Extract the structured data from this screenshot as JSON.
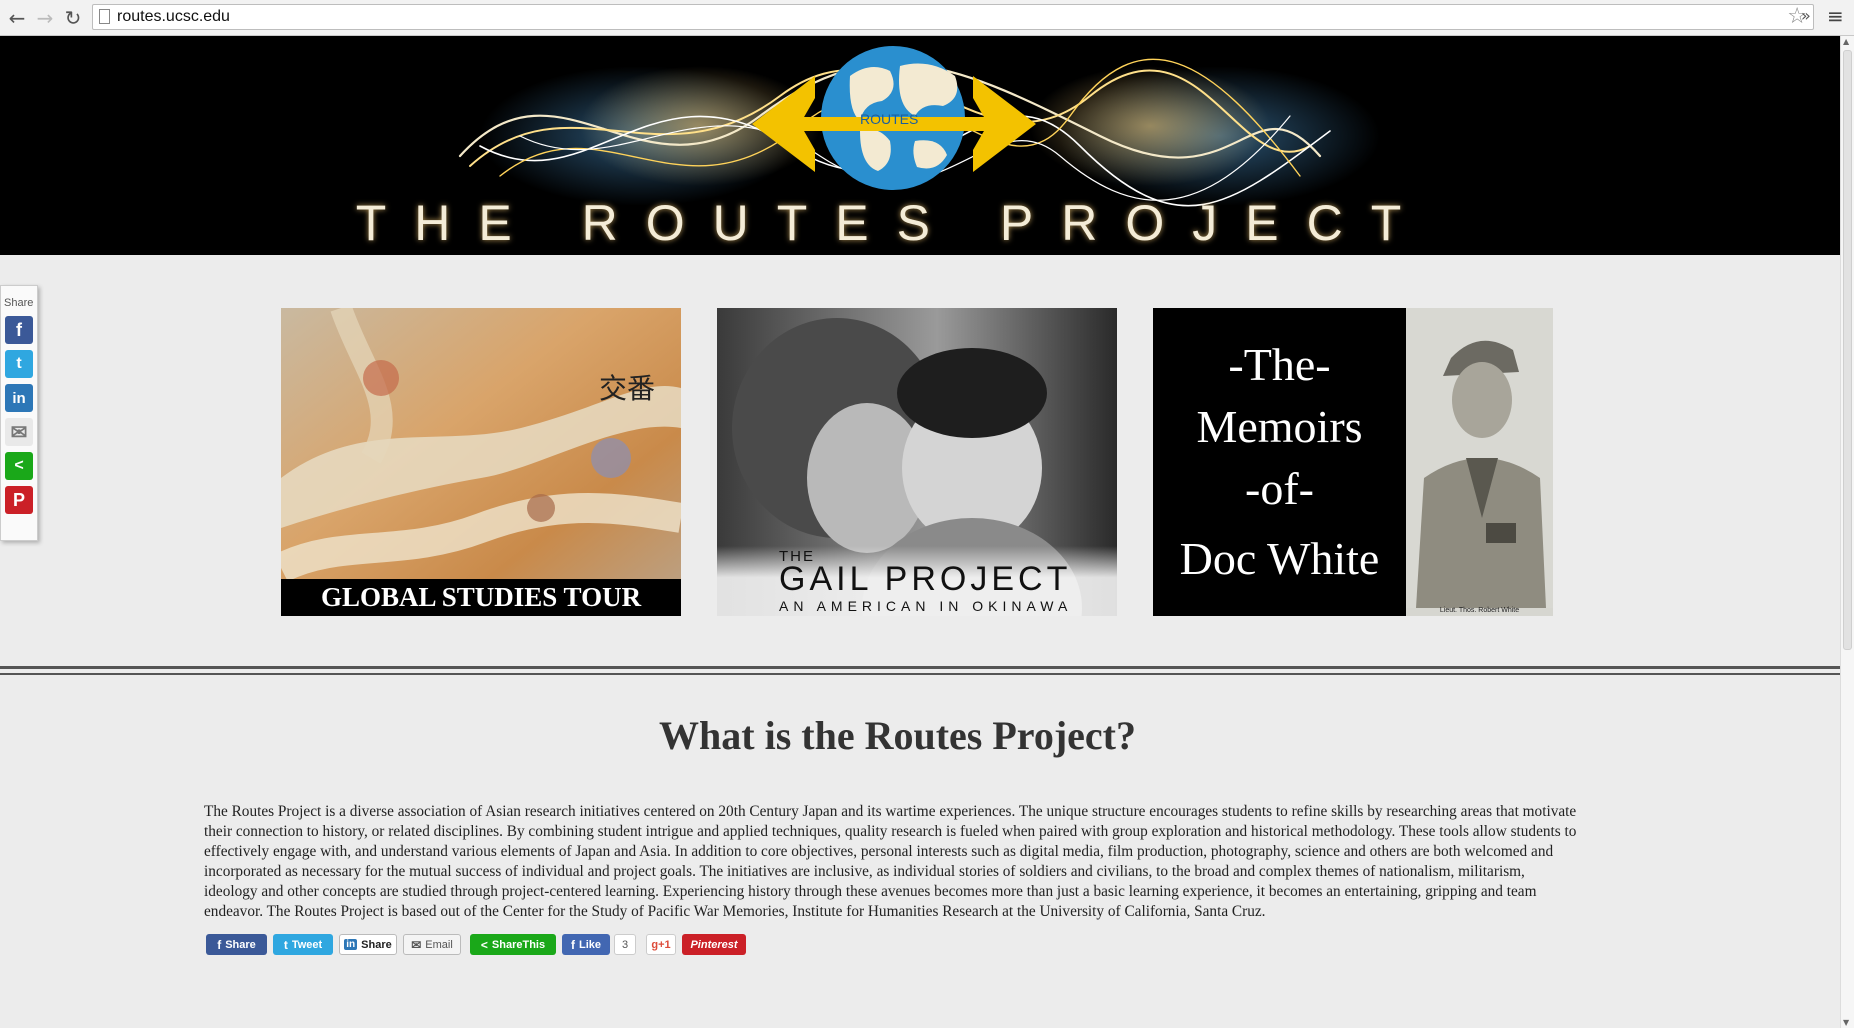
{
  "browser": {
    "url": "routes.ucsc.edu",
    "back_icon": "←",
    "forward_icon": "→",
    "reload_icon": "↻",
    "star_icon": "☆",
    "extensions_icon": "»",
    "menu_icon": "≡"
  },
  "header": {
    "logo_text": "ROUTES",
    "title": "THE ROUTES PROJECT",
    "colors": {
      "globe": "#2a8fcf",
      "arrows": "#f3c200",
      "background": "#000000"
    }
  },
  "share_sidebar": {
    "label": "Share",
    "buttons": [
      {
        "name": "facebook",
        "glyph": "f",
        "color": "#3b5998"
      },
      {
        "name": "twitter",
        "glyph": "t",
        "color": "#2fa7e0"
      },
      {
        "name": "linkedin",
        "glyph": "in",
        "color": "#2d77b7"
      },
      {
        "name": "email",
        "glyph": "✉",
        "color": "#e9e9e9"
      },
      {
        "name": "sharethis",
        "glyph": "<",
        "color": "#1aa819"
      },
      {
        "name": "pinterest",
        "glyph": "P",
        "color": "#cb2027"
      }
    ]
  },
  "tiles": {
    "tour": {
      "caption": "GLOBAL STUDIES TOUR",
      "sign_text": "交番"
    },
    "gail": {
      "the": "THE",
      "title": "GAIL PROJECT",
      "subtitle": "AN AMERICAN IN OKINAWA"
    },
    "doc": {
      "lines": [
        "-The-",
        "Memoirs",
        "-of-",
        "Doc White"
      ],
      "photo_caption": "Lieut. Thos. Robert White"
    }
  },
  "about": {
    "heading": "What is the Routes Project?",
    "body": "The Routes Project is a diverse association of Asian research initiatives centered on 20th Century Japan and its wartime experiences. The unique structure encourages students to refine skills by researching areas that motivate their connection to history, or related disciplines. By combining student intrigue and applied techniques, quality research is fueled when paired with group exploration and historical methodology. These tools allow students to effectively engage with, and understand various elements of Japan and Asia. In addition to core objectives, personal interests such as digital media, film production, photography, science and others are both welcomed and incorporated as necessary for the mutual success of individual and project goals. The initiatives are inclusive, as individual stories of soldiers and civilians, to the broad and complex themes of nationalism, militarism, ideology and other concepts are studied through project-centered learning. Experiencing history through these avenues becomes more than just a basic learning experience, it becomes an entertaining, gripping and team endeavor. The Routes Project is based out of the Center for the Study of Pacific War Memories, Institute for Humanities Research at the University of California, Santa Cruz."
  },
  "share_row": {
    "facebook_share": "Share",
    "tweet": "Tweet",
    "linkedin_share": "Share",
    "email": "Email",
    "sharethis": "ShareThis",
    "like": "Like",
    "like_count": "3",
    "gplus": "g+1",
    "pinterest": "Pinterest"
  }
}
